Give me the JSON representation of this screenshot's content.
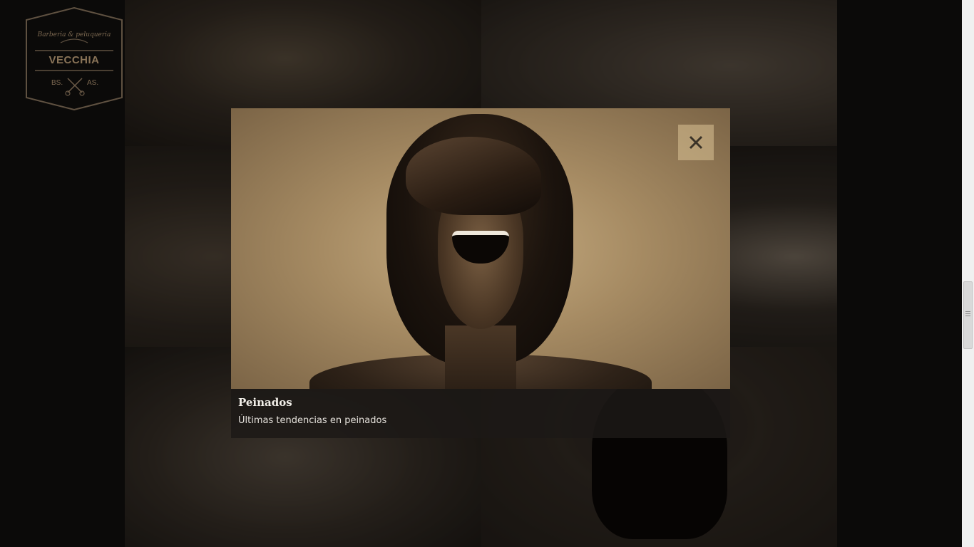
{
  "brand": {
    "line1": "Barberia & peluqueria",
    "name": "VECCHIA",
    "city_left": "BS.",
    "city_right": "AS.",
    "color": "#8a7458"
  },
  "gallery": {
    "tiles": [
      "barber-shave-photo",
      "scissors-cut-photo",
      "haircut-photo",
      "robe-photo",
      "salon-waiting-photo",
      "laughing-woman-photo"
    ]
  },
  "lightbox": {
    "title": "Peinados",
    "subtitle": "Últimas tendencias en peinados",
    "close_icon": "close-icon",
    "image": "laughing-woman-bob-haircut"
  },
  "colors": {
    "background": "#0b0a09",
    "close_button": "#c8ad80",
    "caption_bg": "#1c1916"
  }
}
